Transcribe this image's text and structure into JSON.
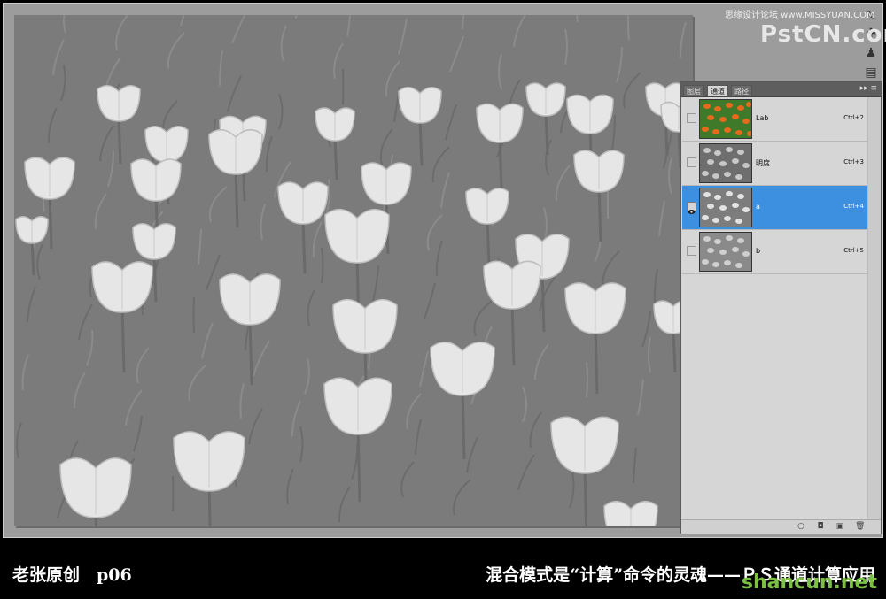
{
  "watermark": {
    "top": "思缘设计论坛 www.MISSYUAN.COM",
    "logo": "PstCN.com",
    "bottom": "shancun.net"
  },
  "panel": {
    "tabs": [
      "图层",
      "通道",
      "路径"
    ],
    "active_tab": 1,
    "menu_glyph": "▸▸ ≡",
    "channels": [
      {
        "label": "Lab",
        "shortcut": "Ctrl+2",
        "thumb": "color",
        "visible": false,
        "selected": false
      },
      {
        "label": "明度",
        "shortcut": "Ctrl+3",
        "thumb": "gray",
        "visible": false,
        "selected": false
      },
      {
        "label": "a",
        "shortcut": "Ctrl+4",
        "thumb": "gray",
        "visible": true,
        "selected": true
      },
      {
        "label": "b",
        "shortcut": "Ctrl+5",
        "thumb": "gray",
        "visible": false,
        "selected": false
      }
    ],
    "footer_icons": [
      "selection-circle-icon",
      "save-selection-icon",
      "new-channel-icon",
      "delete-channel-icon"
    ]
  },
  "toolstrip": [
    "brush-icon",
    "heal-icon",
    "stamp-icon",
    "type-icon"
  ],
  "caption": {
    "left": "老张原创　p06",
    "right": "混合模式是“计算”命令的灵魂——ＰＳ通道计算应用"
  },
  "colors": {
    "selected_row": "#3d8fe0",
    "canvas_bg": "#797979",
    "tulip": "#e9e9e9"
  }
}
